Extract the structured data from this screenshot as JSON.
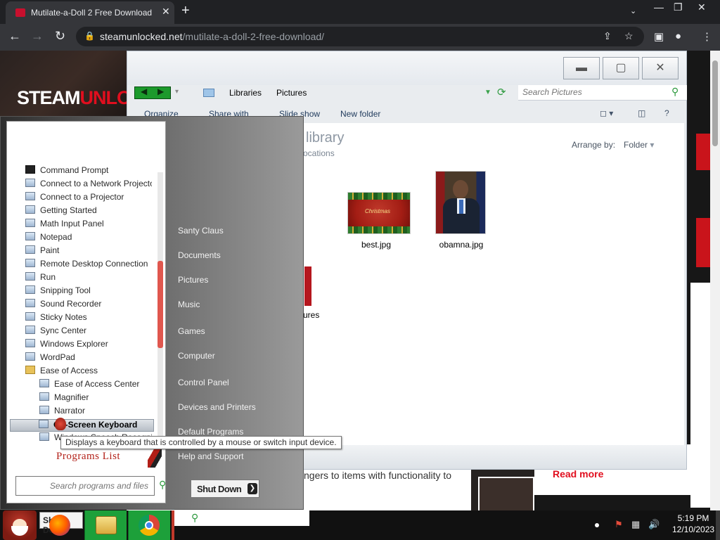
{
  "browser": {
    "tab_title": "Mutilate-a-Doll 2 Free Download",
    "url_host": "steamunlocked.net",
    "url_path": "/mutilate-a-doll-2-free-download/"
  },
  "webpage": {
    "logo_white": "STEAM",
    "logo_red": "UNLOCKED",
    "snippet": "ngers to items with functionality to",
    "read_more": "Read more"
  },
  "explorer": {
    "breadcrumb": [
      "Libraries",
      "Pictures"
    ],
    "search_placeholder": "Search Pictures",
    "commands": {
      "organize": "Organize",
      "share_with": "Share with",
      "slide_show": "Slide show",
      "new_folder": "New folder"
    },
    "library_title": "library",
    "library_sub": "ocations",
    "arrange_label": "Arrange by:",
    "arrange_value": "Folder",
    "partial_file": "ures",
    "files": [
      {
        "name": "best.jpg",
        "thumb_text": "Christmas"
      },
      {
        "name": "obamna.jpg"
      }
    ]
  },
  "startmenu": {
    "programs": [
      "Command Prompt",
      "Connect to a Network Projector",
      "Connect to a Projector",
      "Getting Started",
      "Math Input Panel",
      "Notepad",
      "Paint",
      "Remote Desktop Connection",
      "Run",
      "Snipping Tool",
      "Sound Recorder",
      "Sticky Notes",
      "Sync Center",
      "Windows Explorer",
      "WordPad",
      "Ease of Access",
      "Ease of Access Center",
      "Magnifier",
      "Narrator",
      "On-Screen Keyboard",
      "Windows Speech Recognition"
    ],
    "programs_list_label": "Programs List",
    "search_placeholder": "Search programs and files",
    "right_links": [
      "Santy Claus",
      "Documents",
      "Pictures",
      "Music",
      "Games",
      "Computer",
      "Control Panel",
      "Devices and Printers",
      "Default Programs",
      "Help and Support"
    ],
    "shutdown_label": "Shut Down",
    "tooltip": "Displays a keyboard that is controlled by a mouse or switch input device."
  },
  "taskbar": {
    "search_label": "Shut Down",
    "time": "5:19 PM",
    "date": "12/10/2023"
  },
  "icons": {
    "tab": "steam-favicon",
    "nav": [
      "back-icon",
      "forward-icon",
      "reload-icon"
    ],
    "omnibox": [
      "lock-icon",
      "share-icon",
      "star-icon"
    ],
    "toolbar": [
      "sidepanel-icon",
      "profile-icon",
      "menu-icon"
    ]
  },
  "colors": {
    "brand_red": "#e10e1e",
    "chrome_dark": "#202124",
    "taskbar_green": "#1da03a"
  }
}
